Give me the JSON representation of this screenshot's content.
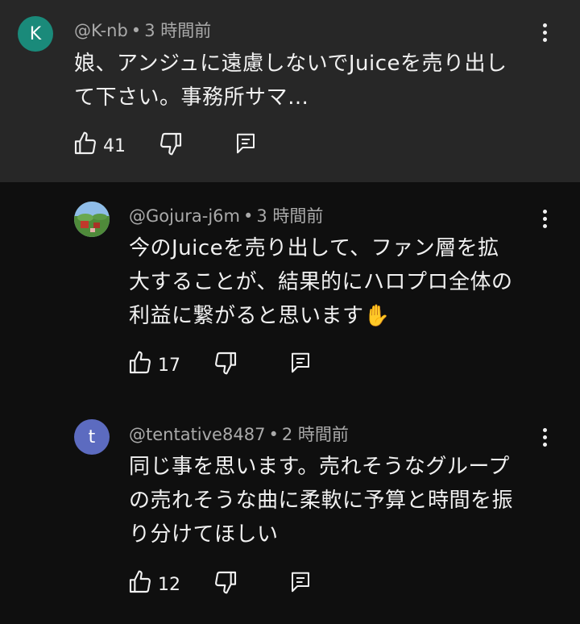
{
  "comments": [
    {
      "avatar_letter": "K",
      "avatar_color": "#1a8a7a",
      "handle": "@K-nb",
      "separator": "•",
      "time": "3 時間前",
      "text_lines": [
        "娘、アンジュに遠慮しないでJuiceを売り出し",
        "て下さい。事務所サマ…"
      ],
      "likes": "41",
      "icons": [
        "thumbs-up-icon",
        "thumbs-down-icon",
        "reply-icon",
        "more-vert-icon"
      ]
    },
    {
      "avatar_letter": "",
      "avatar_color": "#6a9a5a",
      "handle": "@Gojura-j6m",
      "separator": "•",
      "time": "3 時間前",
      "text_lines": [
        "今のJuiceを売り出して、ファン層を拡",
        "大することが、結果的にハロプロ全体の",
        "利益に繋がると思います✋"
      ],
      "likes": "17",
      "icons": [
        "thumbs-up-icon",
        "thumbs-down-icon",
        "reply-icon",
        "more-vert-icon"
      ]
    },
    {
      "avatar_letter": "t",
      "avatar_color": "#5c6bc0",
      "handle": "@tentative8487",
      "separator": "•",
      "time": "2 時間前",
      "text_lines": [
        "同じ事を思います。売れそうなグループ",
        "の売れそうな曲に柔軟に予算と時間を振",
        "り分けてほしい"
      ],
      "likes": "12",
      "icons": [
        "thumbs-up-icon",
        "thumbs-down-icon",
        "reply-icon",
        "more-vert-icon"
      ]
    }
  ]
}
